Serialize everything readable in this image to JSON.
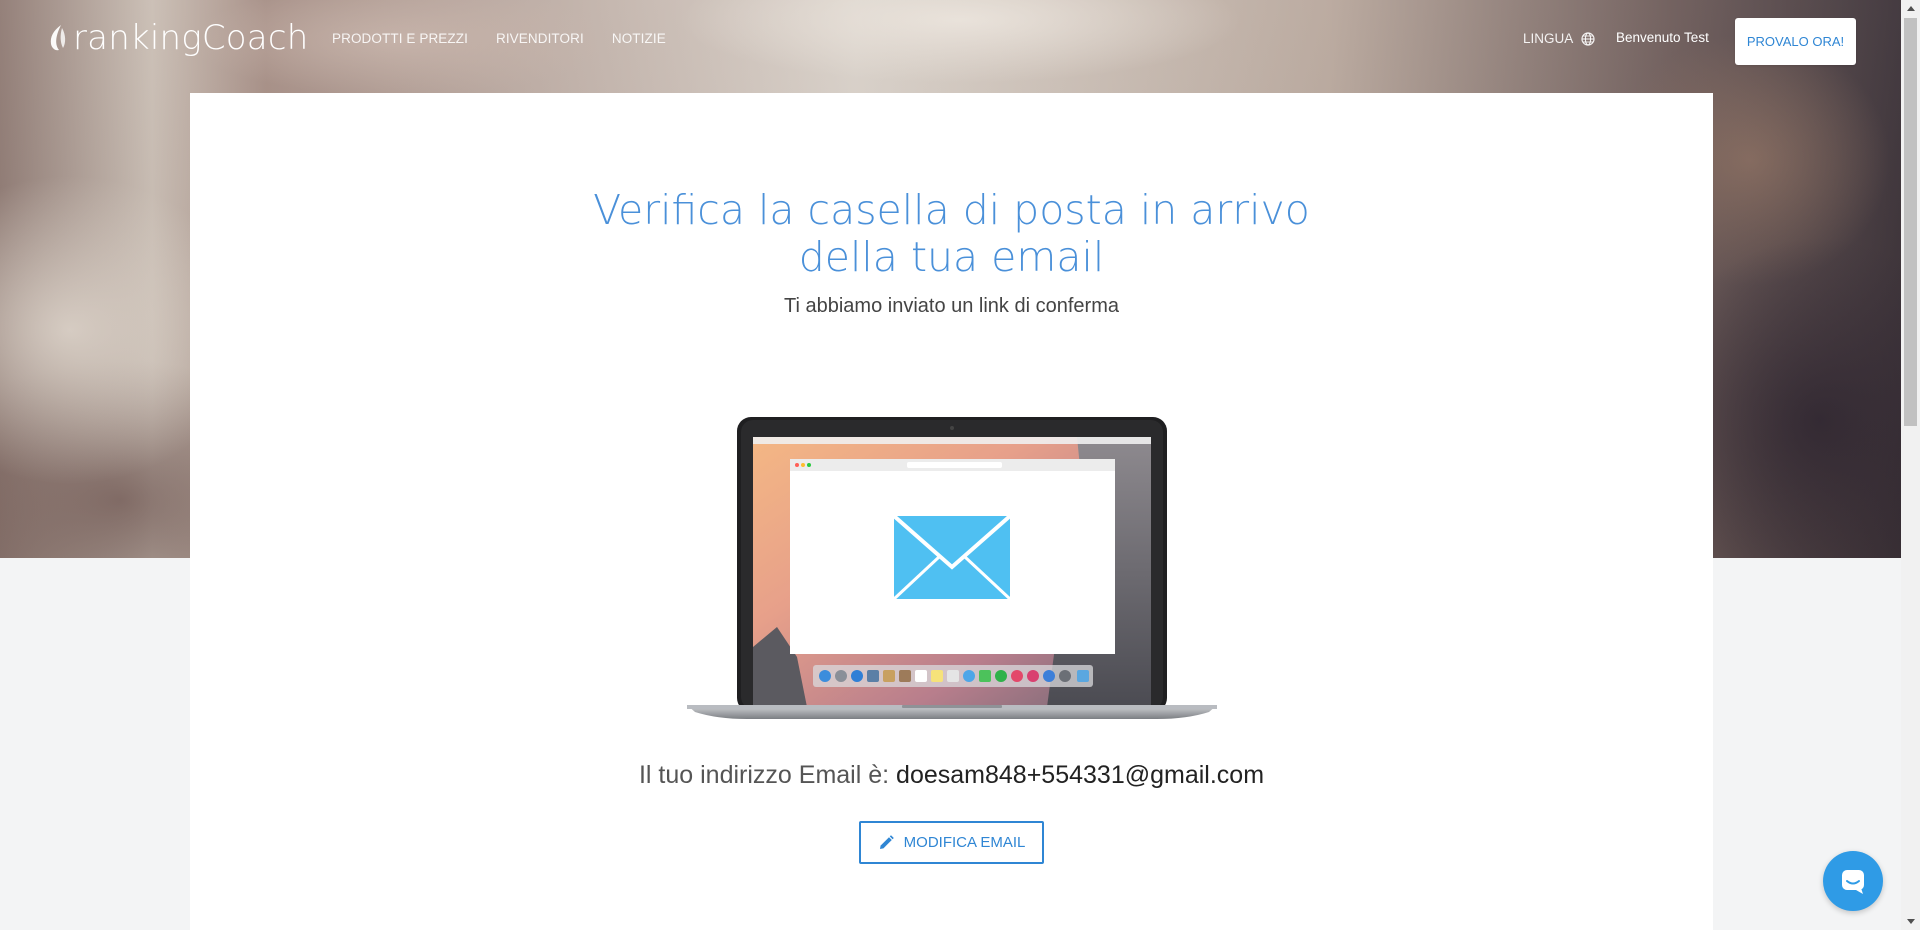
{
  "header": {
    "logo_text": "rankingCoach",
    "nav": [
      {
        "label": "PRODOTTI E PREZZI"
      },
      {
        "label": "RIVENDITORI"
      },
      {
        "label": "NOTIZIE"
      }
    ],
    "language_label": "LINGUA",
    "welcome_text": "Benvenuto Test",
    "cta_label": "PROVALO ORA!"
  },
  "main": {
    "title_line1": "Verifica la casella di posta in arrivo",
    "title_line2": "della tua email",
    "subtitle": "Ti abbiamo inviato un link di conferma",
    "email_prefix": "Il tuo indirizzo Email è:",
    "email_value": "doesam848+554331@gmail.com",
    "edit_button_label": "MODIFICA EMAIL"
  },
  "colors": {
    "accent": "#2f86d4",
    "title": "#4a90d9",
    "envelope": "#4fc0f2",
    "chat": "#2f9be6"
  },
  "icons": {
    "globe": "globe-icon",
    "pencil": "pencil-icon",
    "chat": "chat-icon",
    "envelope": "envelope-icon"
  }
}
